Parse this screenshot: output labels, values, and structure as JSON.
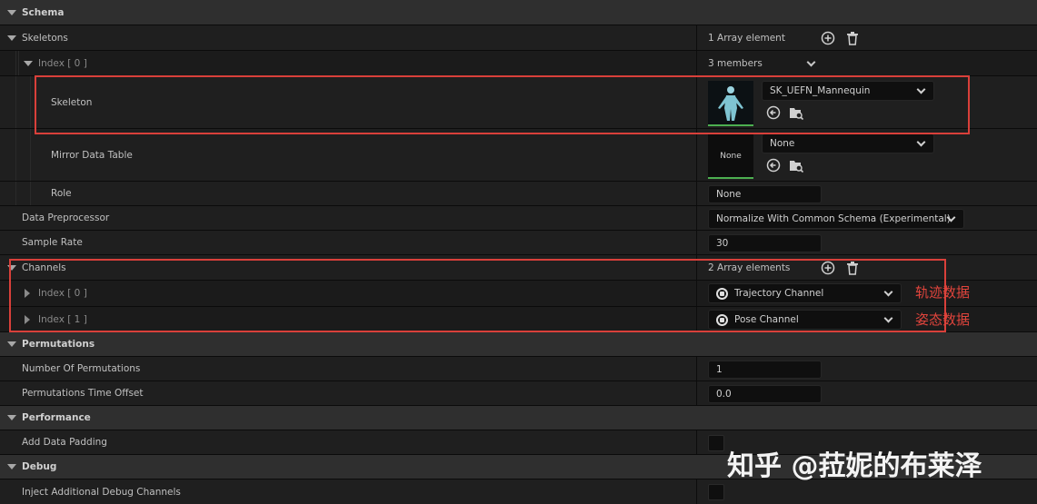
{
  "categories": {
    "schema": "Schema",
    "permutations": "Permutations",
    "performance": "Performance",
    "debug": "Debug"
  },
  "skeletons": {
    "label": "Skeletons",
    "count": "1 Array element",
    "index_label": "Index [ 0 ]",
    "members": "3 members",
    "skeleton_label": "Skeleton",
    "skeleton_value": "SK_UEFN_Mannequin",
    "mirror_label": "Mirror Data Table",
    "mirror_thumb": "None",
    "mirror_value": "None",
    "role_label": "Role",
    "role_value": "None"
  },
  "data_preprocessor": {
    "label": "Data Preprocessor",
    "value": "Normalize With Common Schema (Experimental)"
  },
  "sample_rate": {
    "label": "Sample Rate",
    "value": "30"
  },
  "channels": {
    "label": "Channels",
    "count": "2 Array elements",
    "items": [
      {
        "index": "Index [ 0 ]",
        "value": "Trajectory Channel",
        "annotation": "轨迹数据"
      },
      {
        "index": "Index [ 1 ]",
        "value": "Pose Channel",
        "annotation": "姿态数据"
      }
    ]
  },
  "permutations": {
    "number_label": "Number Of Permutations",
    "number_value": "1",
    "offset_label": "Permutations Time Offset",
    "offset_value": "0.0"
  },
  "performance": {
    "padding_label": "Add Data Padding"
  },
  "debug": {
    "inject_label": "Inject Additional Debug Channels"
  },
  "watermark": "知乎 @菈妮的布莱泽",
  "colors": {
    "highlight_border": "#d9403a",
    "thumbnail_underline": "#4caf50"
  }
}
